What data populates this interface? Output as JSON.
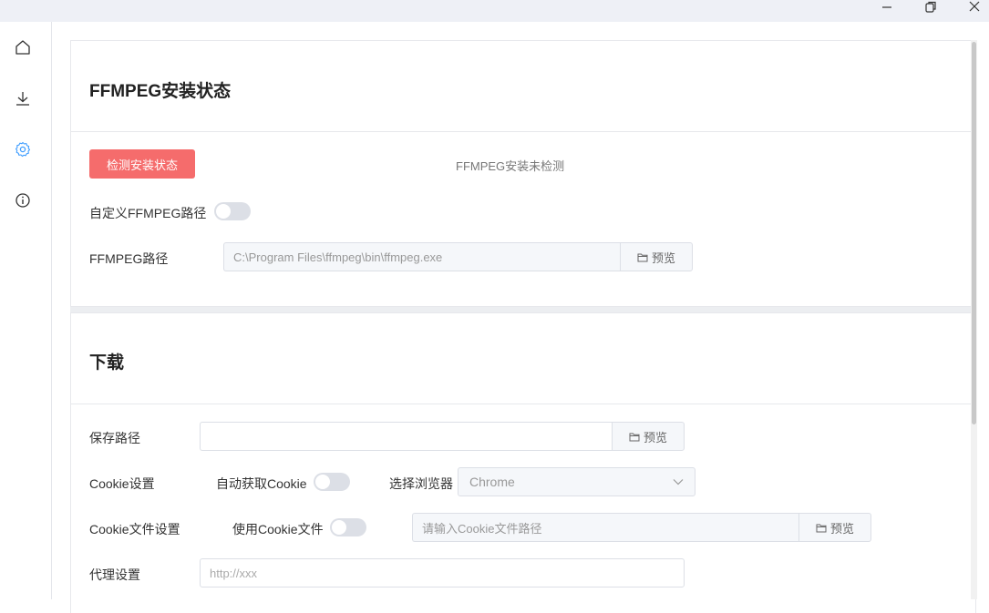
{
  "sidebar": {
    "items": [
      {
        "icon": "home-icon"
      },
      {
        "icon": "download-icon"
      },
      {
        "icon": "settings-icon",
        "active": true
      },
      {
        "icon": "info-icon"
      }
    ],
    "accent": "#409eff"
  },
  "ffmpeg": {
    "title": "FFMPEG安装状态",
    "check_button": "检测安装状态",
    "status": "FFMPEG安装未检测",
    "custom_path_label": "自定义FFMPEG路径",
    "custom_path_enabled": false,
    "path_label": "FFMPEG路径",
    "path_value": "C:\\Program Files\\ffmpeg\\bin\\ffmpeg.exe",
    "browse_label": "预览"
  },
  "download": {
    "title": "下载",
    "save_path_label": "保存路径",
    "save_path_value": "",
    "save_browse_label": "预览",
    "cookie_label": "Cookie设置",
    "auto_cookie_label": "自动获取Cookie",
    "auto_cookie_enabled": false,
    "browser_label": "选择浏览器",
    "browser_value": "Chrome",
    "cookie_file_label": "Cookie文件设置",
    "use_cookie_file_label": "使用Cookie文件",
    "use_cookie_file_enabled": false,
    "cookie_file_placeholder": "请输入Cookie文件路径",
    "cookie_file_browse_label": "预览",
    "proxy_label": "代理设置",
    "proxy_placeholder": "http://xxx"
  },
  "colors": {
    "danger": "#f56c6c",
    "border": "#dcdfe6"
  }
}
